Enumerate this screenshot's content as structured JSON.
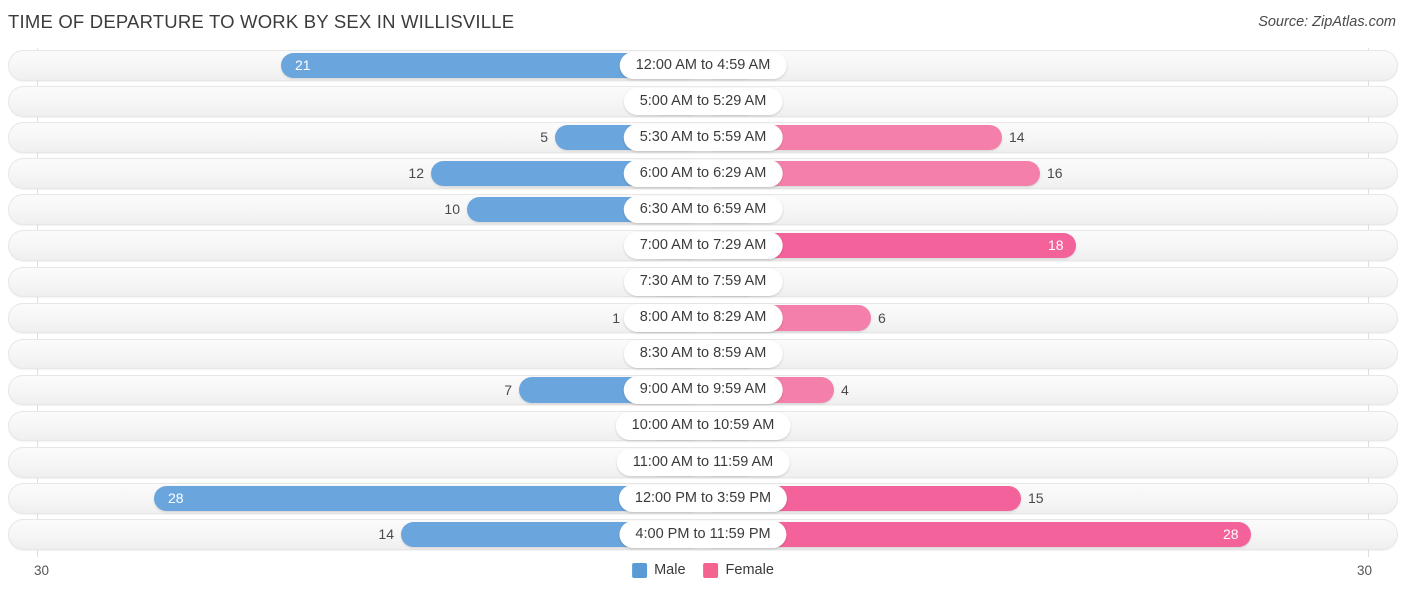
{
  "header": {
    "title": "TIME OF DEPARTURE TO WORK BY SEX IN WILLISVILLE",
    "source": "Source: ZipAtlas.com"
  },
  "legend": {
    "male_label": "Male",
    "female_label": "Female",
    "male_color": "#5b9bd5",
    "female_color": "#f4628f"
  },
  "axis": {
    "left_max": "30",
    "right_max": "30"
  },
  "colors": {
    "male_bar": "#6aa6dd",
    "male_bar_zero": "#aecbf0",
    "female_bar": "#f4629b",
    "female_bar_mid": "#f57fab",
    "female_bar_zero": "#f9aec5",
    "track": "#f6f6f6",
    "label_pill": "#ffffff"
  },
  "chart_data": {
    "type": "bar",
    "orientation": "horizontal-diverging",
    "title": "TIME OF DEPARTURE TO WORK BY SEX IN WILLISVILLE",
    "xlabel": "",
    "ylabel": "",
    "xlim": [
      30,
      30
    ],
    "grid": false,
    "legend_position": "bottom-center",
    "categories": [
      "12:00 AM to 4:59 AM",
      "5:00 AM to 5:29 AM",
      "5:30 AM to 5:59 AM",
      "6:00 AM to 6:29 AM",
      "6:30 AM to 6:59 AM",
      "7:00 AM to 7:29 AM",
      "7:30 AM to 7:59 AM",
      "8:00 AM to 8:29 AM",
      "8:30 AM to 8:59 AM",
      "9:00 AM to 9:59 AM",
      "10:00 AM to 10:59 AM",
      "11:00 AM to 11:59 AM",
      "12:00 PM to 3:59 PM",
      "4:00 PM to 11:59 PM"
    ],
    "series": [
      {
        "name": "Male",
        "color": "#5b9bd5",
        "values": [
          21,
          0,
          5,
          12,
          10,
          0,
          0,
          1,
          0,
          7,
          0,
          0,
          28,
          14
        ]
      },
      {
        "name": "Female",
        "color": "#f4628f",
        "values": [
          0,
          0,
          14,
          16,
          0,
          18,
          0,
          6,
          0,
          4,
          0,
          0,
          15,
          28
        ]
      }
    ]
  },
  "rows": [
    {
      "label": "12:00 AM to 4:59 AM",
      "male": {
        "value": "21",
        "len": 422,
        "zero": false,
        "inside": true
      },
      "female": {
        "value": "0",
        "len": 55,
        "zero": true,
        "inside": false
      }
    },
    {
      "label": "5:00 AM to 5:29 AM",
      "male": {
        "value": "0",
        "len": 55,
        "zero": true,
        "inside": false
      },
      "female": {
        "value": "0",
        "len": 55,
        "zero": true,
        "inside": false
      }
    },
    {
      "label": "5:30 AM to 5:59 AM",
      "male": {
        "value": "5",
        "len": 148,
        "zero": false,
        "inside": false
      },
      "female": {
        "value": "14",
        "len": 299,
        "zero": false,
        "mid": true,
        "inside": false
      }
    },
    {
      "label": "6:00 AM to 6:29 AM",
      "male": {
        "value": "12",
        "len": 272,
        "zero": false,
        "inside": false
      },
      "female": {
        "value": "16",
        "len": 337,
        "zero": false,
        "mid": true,
        "inside": false
      }
    },
    {
      "label": "6:30 AM to 6:59 AM",
      "male": {
        "value": "10",
        "len": 236,
        "zero": false,
        "inside": false
      },
      "female": {
        "value": "0",
        "len": 55,
        "zero": true,
        "inside": false
      }
    },
    {
      "label": "7:00 AM to 7:29 AM",
      "male": {
        "value": "0",
        "len": 55,
        "zero": true,
        "inside": false
      },
      "female": {
        "value": "18",
        "len": 373,
        "zero": false,
        "inside": true
      }
    },
    {
      "label": "7:30 AM to 7:59 AM",
      "male": {
        "value": "0",
        "len": 55,
        "zero": true,
        "inside": false
      },
      "female": {
        "value": "0",
        "len": 55,
        "zero": true,
        "inside": false
      }
    },
    {
      "label": "8:00 AM to 8:29 AM",
      "male": {
        "value": "1",
        "len": 76,
        "zero": false,
        "inside": false
      },
      "female": {
        "value": "6",
        "len": 168,
        "zero": false,
        "mid": true,
        "inside": false
      }
    },
    {
      "label": "8:30 AM to 8:59 AM",
      "male": {
        "value": "0",
        "len": 55,
        "zero": true,
        "inside": false
      },
      "female": {
        "value": "0",
        "len": 55,
        "zero": true,
        "inside": false
      }
    },
    {
      "label": "9:00 AM to 9:59 AM",
      "male": {
        "value": "7",
        "len": 184,
        "zero": false,
        "inside": false
      },
      "female": {
        "value": "4",
        "len": 131,
        "zero": false,
        "mid": true,
        "inside": false
      }
    },
    {
      "label": "10:00 AM to 10:59 AM",
      "male": {
        "value": "0",
        "len": 55,
        "zero": true,
        "inside": false
      },
      "female": {
        "value": "0",
        "len": 55,
        "zero": true,
        "inside": false
      }
    },
    {
      "label": "11:00 AM to 11:59 AM",
      "male": {
        "value": "0",
        "len": 55,
        "zero": true,
        "inside": false
      },
      "female": {
        "value": "0",
        "len": 55,
        "zero": true,
        "inside": false
      }
    },
    {
      "label": "12:00 PM to 3:59 PM",
      "male": {
        "value": "28",
        "len": 549,
        "zero": false,
        "inside": true
      },
      "female": {
        "value": "15",
        "len": 318,
        "zero": false,
        "inside": false
      }
    },
    {
      "label": "4:00 PM to 11:59 PM",
      "male": {
        "value": "14",
        "len": 302,
        "zero": false,
        "inside": false
      },
      "female": {
        "value": "28",
        "len": 548,
        "zero": false,
        "inside": true
      }
    }
  ]
}
